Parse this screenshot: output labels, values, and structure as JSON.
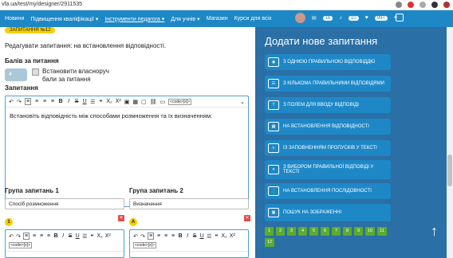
{
  "browser": {
    "url": "vfa.ua/test/my/designer/2911535"
  },
  "nav": {
    "items": [
      "Новини",
      "Підвищення кваліфікації ▾",
      "Інструменти педагога ▾",
      "Для учнів ▾",
      "Магазин",
      "Курси для всіх"
    ],
    "badge1": "16",
    "badge2": "10",
    "badge3": "99+"
  },
  "left": {
    "tag": "ЗАПИТАННЯ №12",
    "description": "Редагувати запитання: на встановлення відповідності.",
    "points_label": "Балів за питання",
    "points_value": "4",
    "custom_points_label": "Встановити власноруч бали за питання",
    "question_label": "Запитання",
    "question_text": "Встановіть відповідність між способами розмноження та їх визначенням:",
    "group1_label": "Група запитань 1",
    "group2_label": "Група запитань 2",
    "group1_value": "Спосіб розмноження",
    "group2_value": "Визначення",
    "row1_left_marker": "1",
    "row1_right_marker": "А"
  },
  "toolbar": {
    "undo": "↶",
    "redo": "↷",
    "bold": "B",
    "italic": "I",
    "strike": "S",
    "underline": "U",
    "list": "☰",
    "quote": "❝",
    "sub": "X₂",
    "sup": "X²",
    "code": "<code>[x]>"
  },
  "right": {
    "title": "Додати нове запитання",
    "buttons": [
      "З ОДНІЄЮ ПРАВИЛЬНОЮ ВІДПОВІДДЮ",
      "З КІЛЬКОМА ПРАВИЛЬНИМИ ВІДПОВІДЯМИ",
      "З ПОЛЕМ ДЛЯ ВВОДУ ВІДПОВІДІ",
      "НА ВСТАНОВЛЕННЯ ВІДПОВІДНОСТІ",
      "ІЗ ЗАПОВНЕННЯМ ПРОПУСКІВ У ТЕКСТІ",
      "З ВИБОРОМ ПРАВИЛЬНОЇ ВІДПОВІДІ У ТЕКСТІ",
      "НА ВСТАНОВЛЕННЯ ПОСЛІДОВНОСТІ",
      "ПОШУК НА ЗОБРАЖЕННІ"
    ],
    "pages": [
      "1",
      "2",
      "3",
      "4",
      "5",
      "6",
      "7",
      "8",
      "9",
      "10",
      "11",
      "12"
    ],
    "up_arrow": "↑"
  },
  "colors": {
    "nav": "#1e88c7",
    "panel": "#2a6fa5",
    "button": "#1e88c7",
    "page": "#5aab2e",
    "tag": "#f5d000"
  }
}
